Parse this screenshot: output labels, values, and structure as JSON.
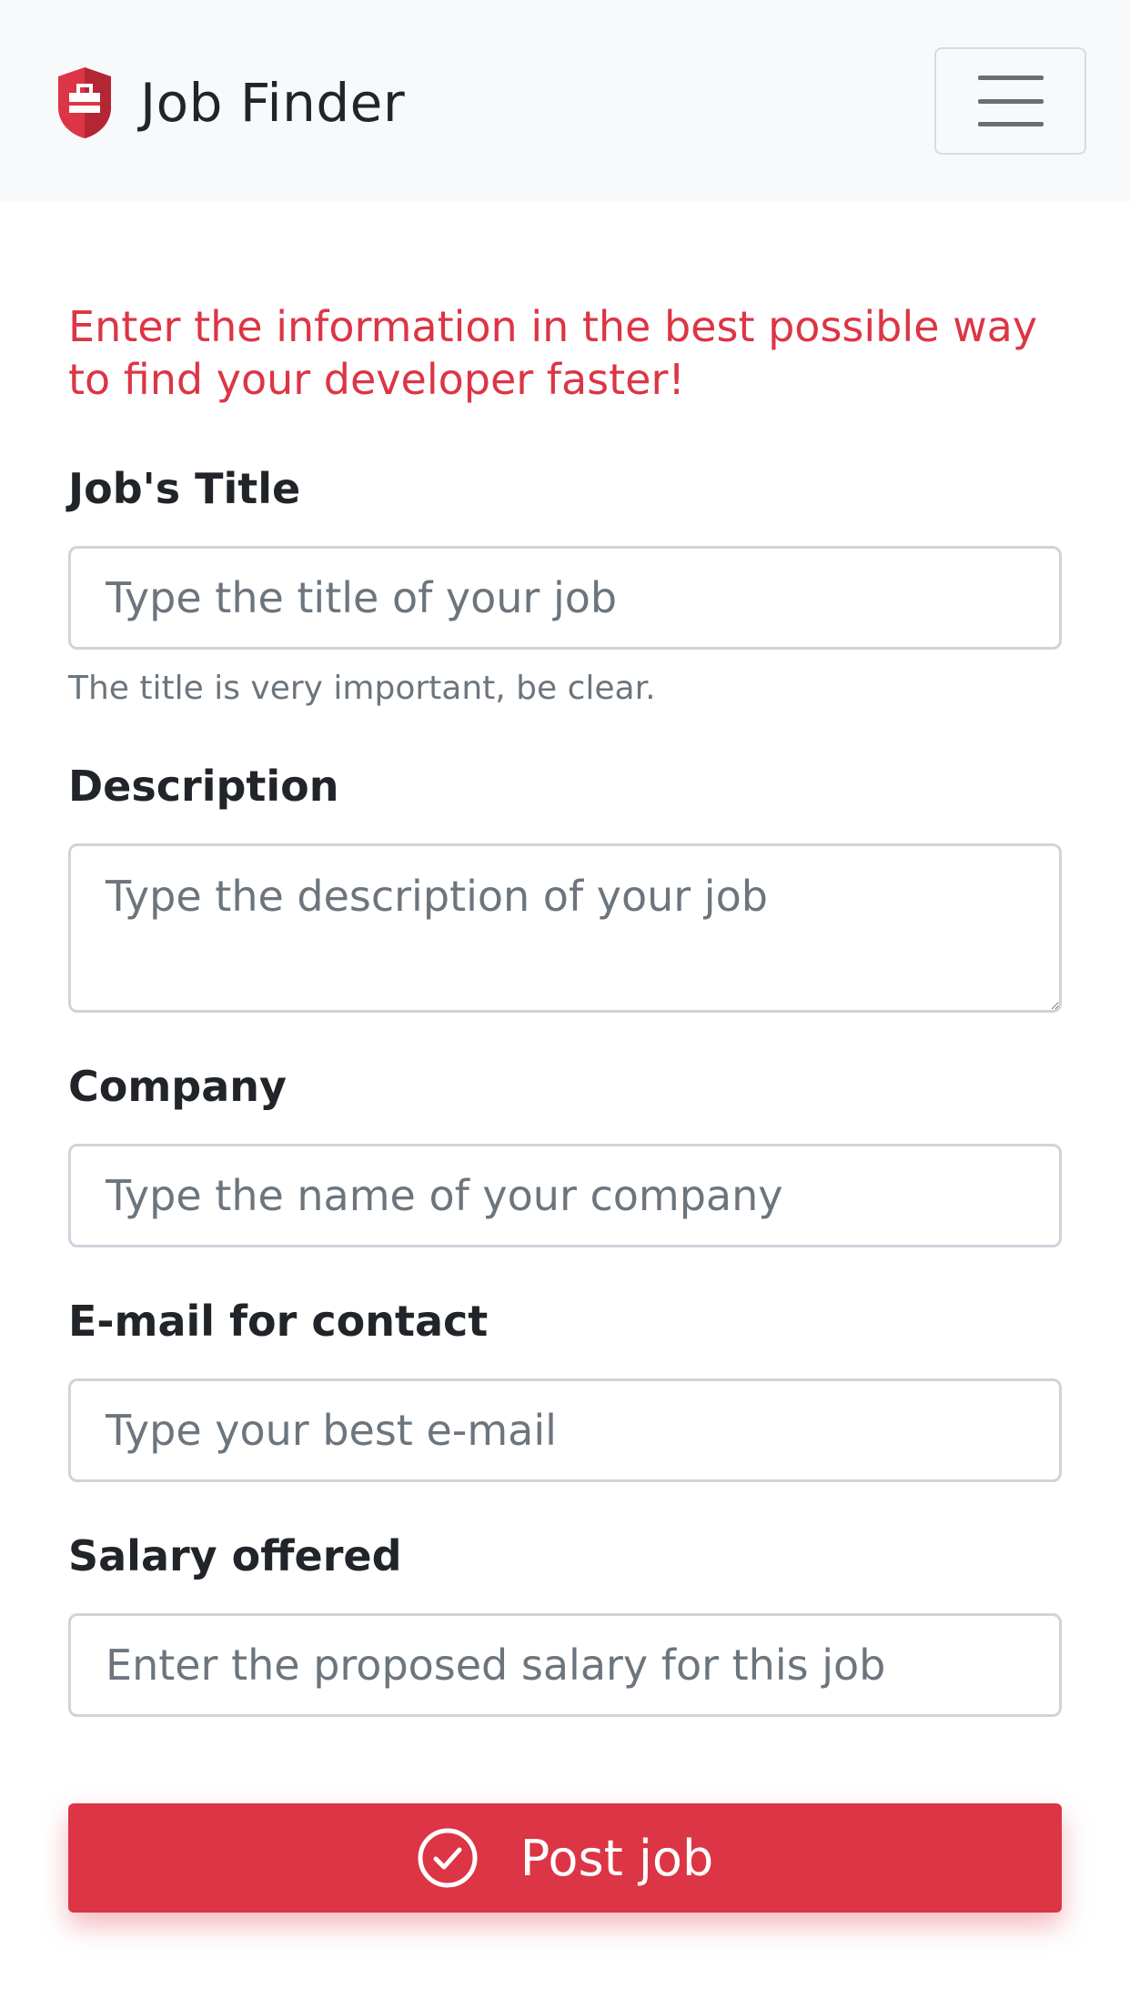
{
  "navbar": {
    "brand_name": "Job Finder",
    "logo_icon": "briefcase-shield-icon",
    "menu_icon": "hamburger-menu-icon"
  },
  "form": {
    "intro": "Enter the information in the best possible way to find your developer faster!",
    "title": {
      "label": "Job's Title",
      "placeholder": "Type the title of your job",
      "help": "The title is very important, be clear."
    },
    "description": {
      "label": "Description",
      "placeholder": "Type the description of your job"
    },
    "company": {
      "label": "Company",
      "placeholder": "Type the name of your company"
    },
    "email": {
      "label": "E-mail for contact",
      "placeholder": "Type your best e-mail"
    },
    "salary": {
      "label": "Salary offered",
      "placeholder": "Enter the proposed salary for this job"
    },
    "submit": {
      "label": "Post job",
      "icon": "check-circle-icon"
    }
  },
  "colors": {
    "accent": "#dc3545",
    "navbar_bg": "#f8f9fa",
    "border": "#ced4da",
    "muted": "#6c757d"
  }
}
